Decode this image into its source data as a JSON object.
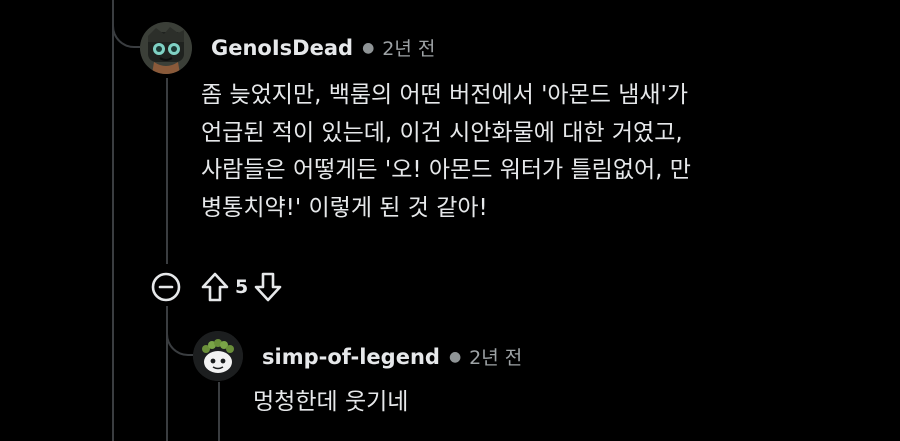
{
  "comments": [
    {
      "username": "GenoIsDead",
      "time": "2년 전",
      "lines": [
        "좀 늦었지만, 백룸의 어떤 버전에서 '아몬드 냄새'가",
        "언급된 적이 있는데, 이건 시안화물에 대한 거였고,",
        "사람들은 어떻게든 '오! 아몬드 워터가 틀림없어, 만",
        "병통치약!' 이렇게 된 것 같아!"
      ],
      "votes": "5"
    },
    {
      "username": "simp-of-legend",
      "time": "2년 전",
      "lines": [
        "멍청한데 웃기네"
      ]
    }
  ],
  "icons": {
    "collapse": "collapse-icon",
    "upvote": "upvote-arrow-icon",
    "downvote": "downvote-arrow-icon",
    "avatar1": "avatar-character-icon",
    "avatar2": "avatar-snoo-icon"
  },
  "colors": {
    "background": "#000000",
    "text": "#e6e8ea",
    "muted": "#9ea3a6",
    "thread_line": "#3a3d40"
  }
}
